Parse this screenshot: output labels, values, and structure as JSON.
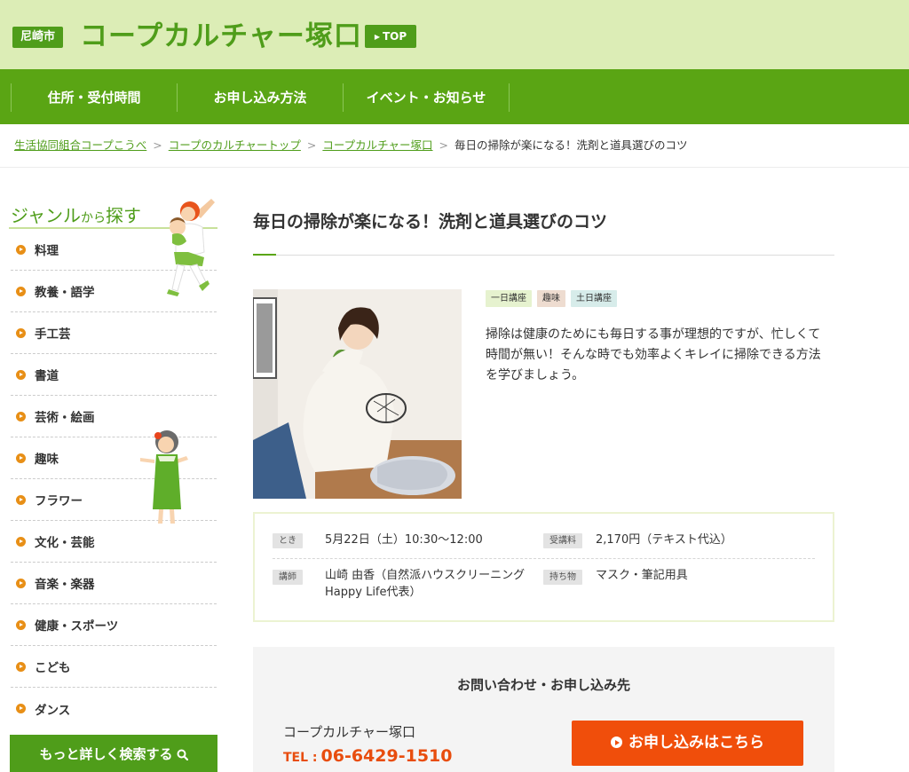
{
  "header": {
    "region": "尼崎市",
    "title": "コープカルチャー塚口",
    "top_button": "TOP"
  },
  "nav": {
    "items": [
      {
        "label": "住所・受付時間"
      },
      {
        "label": "お申し込み方法"
      },
      {
        "label": "イベント・お知らせ"
      }
    ]
  },
  "breadcrumb": {
    "items": [
      {
        "label": "生活協同組合コープこうべ"
      },
      {
        "label": "コープのカルチャートップ"
      },
      {
        "label": "コープカルチャー塚口"
      }
    ],
    "separator": ">",
    "current": "毎日の掃除が楽になる！洗剤と道具選びのコツ"
  },
  "sidebar": {
    "genre_title_main": "ジャンル",
    "genre_title_connector": "から",
    "genre_title_end": "探す",
    "genres": [
      {
        "label": "料理"
      },
      {
        "label": "教養・語学"
      },
      {
        "label": "手工芸"
      },
      {
        "label": "書道"
      },
      {
        "label": "芸術・絵画"
      },
      {
        "label": "趣味"
      },
      {
        "label": "フラワー"
      },
      {
        "label": "文化・芸能"
      },
      {
        "label": "音楽・楽器"
      },
      {
        "label": "健康・スポーツ"
      },
      {
        "label": "こども"
      },
      {
        "label": "ダンス"
      }
    ],
    "search_more": "もっと詳しく検索する"
  },
  "course": {
    "title": "毎日の掃除が楽になる！洗剤と道具選びのコツ",
    "tags": [
      {
        "label": "一日講座"
      },
      {
        "label": "趣味"
      },
      {
        "label": "土日講座"
      }
    ],
    "description": "掃除は健康のためにも毎日する事が理想的ですが、忙しくて時間が無い！そんな時でも効率よくキレイに掃除できる方法を学びましょう。",
    "info": {
      "when_label": "とき",
      "when_value": "5月22日（土）10:30〜12:00",
      "fee_label": "受講料",
      "fee_value": "2,170円（テキスト代込）",
      "instructor_label": "講師",
      "instructor_value_line1": "山崎 由香（自然派ハウスクリーニング",
      "instructor_value_line2": "Happy Life代表）",
      "items_label": "持ち物",
      "items_value": "マスク・筆記用具"
    }
  },
  "contact": {
    "title": "お問い合わせ・お申し込み先",
    "name": "コープカルチャー塚口",
    "tel_label": "TEL :",
    "tel_number": "06-6429-1510",
    "apply_button": "お申し込みはこちら"
  },
  "colors": {
    "brand_green": "#4f9d1a",
    "nav_green": "#5aa514",
    "header_bg": "#dcedb6",
    "accent_orange": "#f04e0b",
    "bullet_orange": "#e88f16"
  }
}
